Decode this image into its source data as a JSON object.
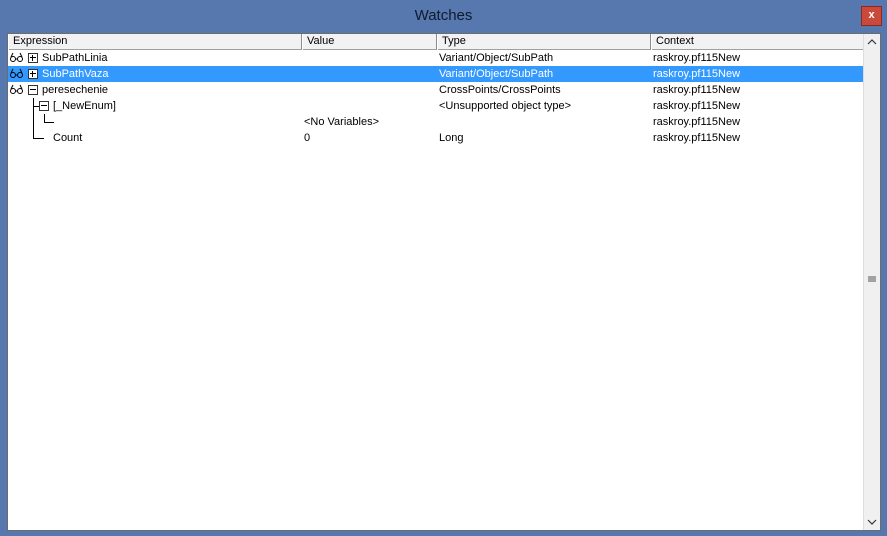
{
  "window": {
    "title": "Watches",
    "close_label": "x"
  },
  "columns": {
    "expression": "Expression",
    "value": "Value",
    "type": "Type",
    "context": "Context"
  },
  "rows": [
    {
      "expression": "SubPathLinia",
      "value": "",
      "type": "Variant/Object/SubPath",
      "context": "raskroy.pf115New",
      "icon": "watch-glasses-icon",
      "expander": "plus"
    },
    {
      "expression": "SubPathVaza",
      "value": "",
      "type": "Variant/Object/SubPath",
      "context": "raskroy.pf115New",
      "icon": "watch-glasses-icon",
      "expander": "plus",
      "selected": true
    },
    {
      "expression": "peresechenie",
      "value": "",
      "type": "CrossPoints/CrossPoints",
      "context": "raskroy.pf115New",
      "icon": "watch-glasses-icon",
      "expander": "minus"
    },
    {
      "expression": "[_NewEnum]",
      "value": "",
      "type": "<Unsupported object type>",
      "context": "raskroy.pf115New",
      "expander": "minus"
    },
    {
      "expression": "",
      "value": "<No Variables>",
      "type": "",
      "context": "raskroy.pf115New"
    },
    {
      "expression": "Count",
      "value": "0",
      "type": "Long",
      "context": "raskroy.pf115New"
    }
  ],
  "colors": {
    "selection": "#3399ff",
    "frame": "#5678ae"
  }
}
